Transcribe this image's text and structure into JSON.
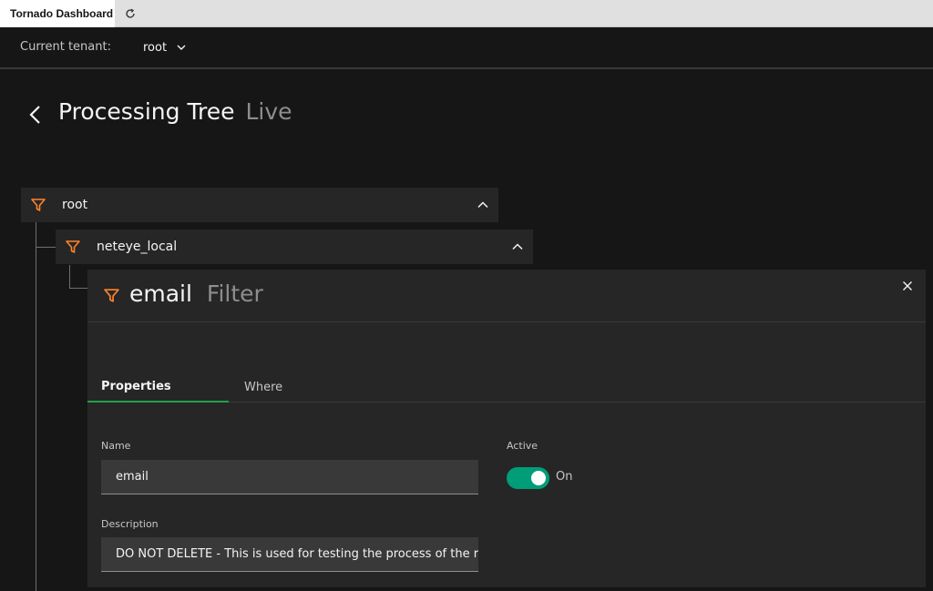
{
  "browser": {
    "tab_title": "Tornado Dashboard",
    "reload_icon": "reload-icon"
  },
  "tenant": {
    "label": "Current tenant:",
    "value": "root"
  },
  "page": {
    "title": "Processing Tree",
    "subtitle": "Live"
  },
  "tree": {
    "nodes": [
      {
        "label": "root",
        "icon": "filter-icon"
      },
      {
        "label": "neteye_local",
        "icon": "filter-icon"
      }
    ]
  },
  "panel": {
    "title": "email",
    "type": "Filter",
    "tabs": [
      {
        "label": "Properties",
        "active": true
      },
      {
        "label": "Where",
        "active": false
      }
    ],
    "fields": {
      "name_label": "Name",
      "name_value": "email",
      "description_label": "Description",
      "description_value": "DO NOT DELETE - This is used for testing the process of the repo",
      "active_label": "Active",
      "active_state": "On",
      "active": true
    }
  },
  "colors": {
    "accent_orange": "#ff832b",
    "tab_indicator": "#24a148",
    "toggle_on": "#009d78"
  }
}
